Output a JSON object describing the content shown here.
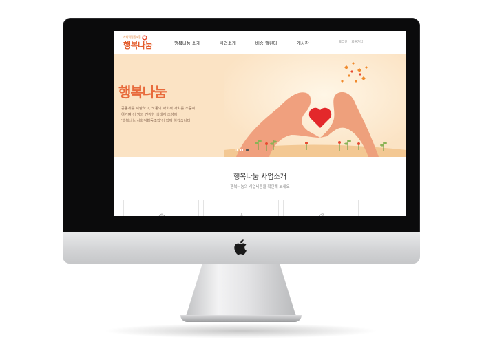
{
  "site": {
    "logo": {
      "tagline": "사회적협동조합",
      "name": "행복나눔"
    },
    "nav": [
      "행복나눔 소개",
      "사업소개",
      "배송 캘린더",
      "게시판"
    ],
    "util": [
      "로그인",
      "회원가입"
    ]
  },
  "hero": {
    "title": "행복나눔",
    "desc_line1": "공동체를 지향하고, 노동의 사회적 가치를 소중히",
    "desc_line2": "여기며 이 땅의 건강한 생태계 조성에",
    "desc_line3": "'행복나눔 사회적협동조합'이 함께 하겠습니다.",
    "slides": 3,
    "active_slide": 3
  },
  "section": {
    "title": "행복나눔 사업소개",
    "subtitle": "행복나눔의 사업내용을 확인해 보세요"
  },
  "icons": {
    "brand": "apple-icon",
    "hero": "heart-hands-icon",
    "cards": [
      "bowl-icon",
      "delivery-icon",
      "leaf-icon"
    ]
  },
  "colors": {
    "accent": "#e35b2a",
    "hero_bg": "#fbe3c4",
    "heart": "#e3282b"
  }
}
